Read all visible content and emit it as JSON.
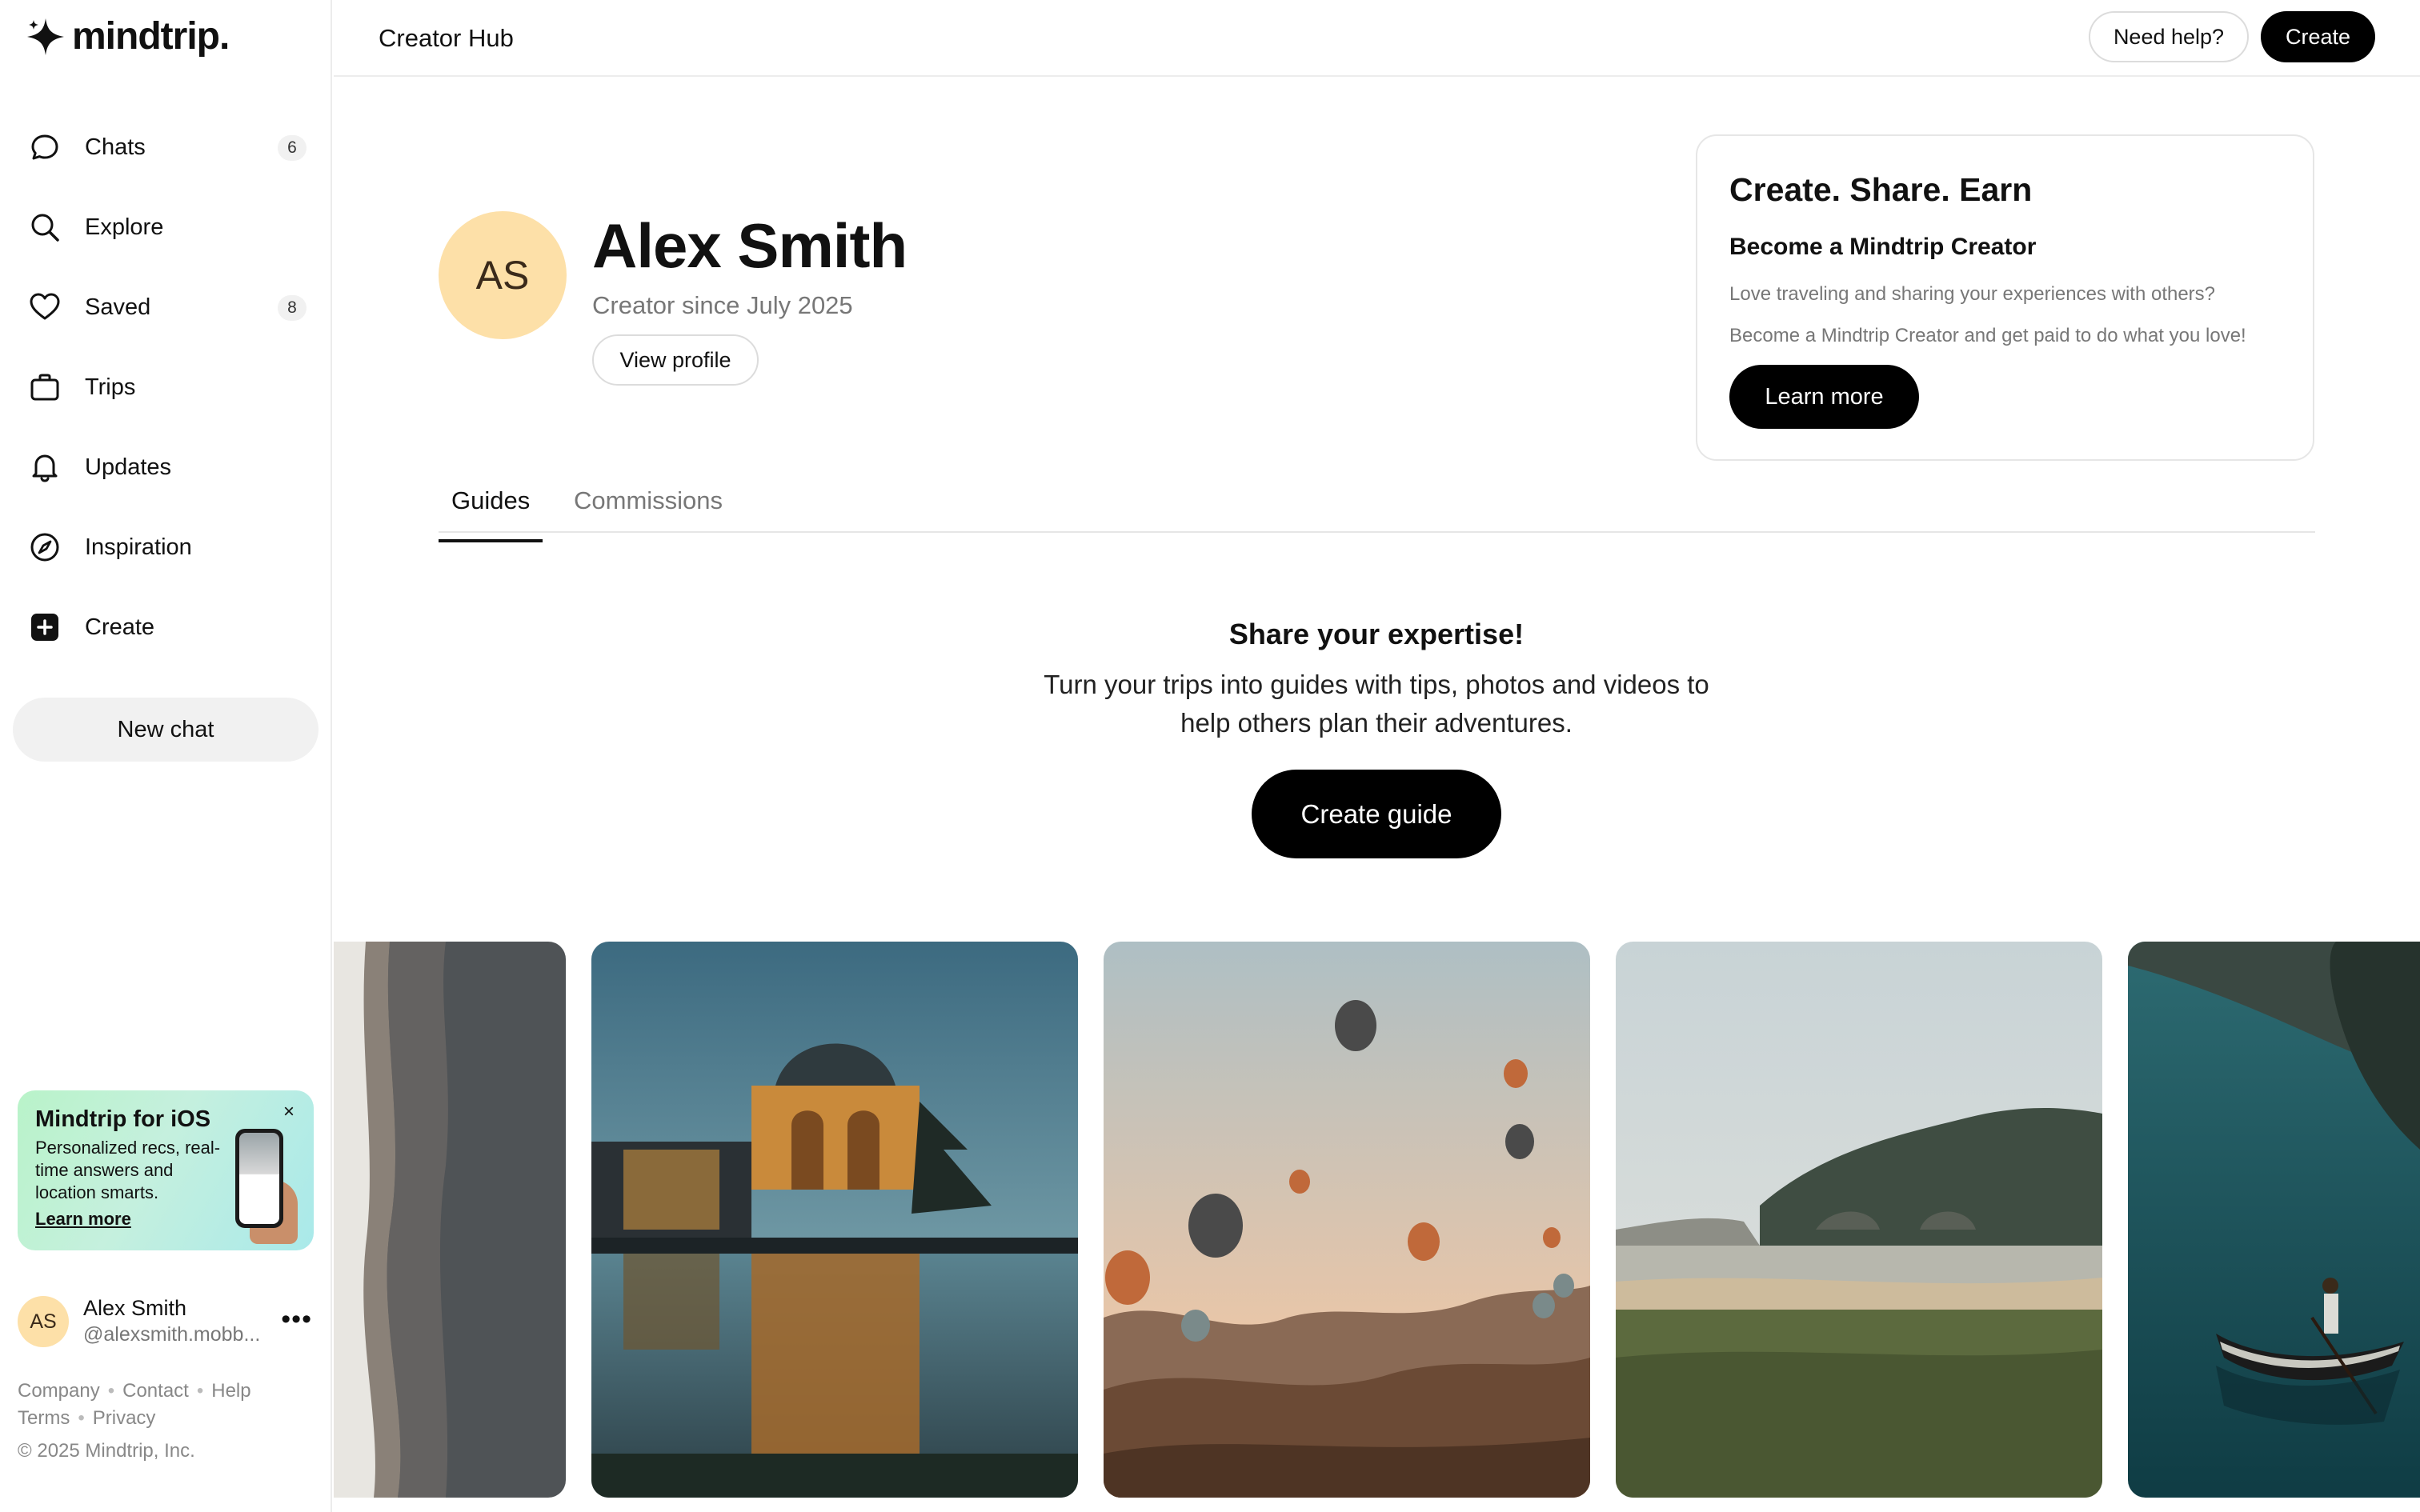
{
  "brand": {
    "name": "mindtrip."
  },
  "sidebar": {
    "items": [
      {
        "label": "Chats",
        "icon": "chat-bubble-icon",
        "badge": "6"
      },
      {
        "label": "Explore",
        "icon": "search-icon",
        "badge": null
      },
      {
        "label": "Saved",
        "icon": "heart-icon",
        "badge": "8"
      },
      {
        "label": "Trips",
        "icon": "suitcase-icon",
        "badge": null
      },
      {
        "label": "Updates",
        "icon": "bell-icon",
        "badge": null
      },
      {
        "label": "Inspiration",
        "icon": "compass-icon",
        "badge": null
      },
      {
        "label": "Create",
        "icon": "plus-square-icon",
        "badge": null
      }
    ],
    "new_chat_label": "New chat",
    "promo": {
      "title": "Mindtrip for iOS",
      "body": "Personalized recs, real-time answers and location smarts.",
      "link": "Learn more",
      "close": "×"
    },
    "user": {
      "initials": "AS",
      "name": "Alex Smith",
      "handle": "@alexsmith.mobb..."
    },
    "footer": {
      "company": "Company",
      "contact": "Contact",
      "help": "Help",
      "terms": "Terms",
      "privacy": "Privacy",
      "copyright": "© 2025 Mindtrip, Inc."
    }
  },
  "header": {
    "title": "Creator Hub",
    "help_label": "Need help?",
    "create_label": "Create"
  },
  "profile": {
    "initials": "AS",
    "name": "Alex Smith",
    "since": "Creator since July 2025",
    "view_profile_label": "View profile"
  },
  "creator_card": {
    "title": "Create. Share. Earn",
    "subtitle": "Become a Mindtrip Creator",
    "line1": "Love traveling and sharing your experiences with others?",
    "line2": "Become a Mindtrip Creator and get paid to do what you love!",
    "button": "Learn more"
  },
  "tabs": [
    {
      "label": "Guides",
      "active": true
    },
    {
      "label": "Commissions",
      "active": false
    }
  ],
  "empty_state": {
    "title": "Share your expertise!",
    "body": "Turn your trips into guides with tips, photos and videos to help others plan their adventures.",
    "button": "Create guide"
  },
  "photos": [
    {
      "name": "coastline-photo"
    },
    {
      "name": "palace-of-fine-arts-photo"
    },
    {
      "name": "hot-air-balloons-photo"
    },
    {
      "name": "misty-beach-photo"
    },
    {
      "name": "lake-canoe-photo"
    }
  ],
  "colors": {
    "accent": "#000000",
    "avatar_bg": "#fde0a8",
    "promo_start": "#b9f3c9",
    "promo_end": "#a9e9ea"
  }
}
